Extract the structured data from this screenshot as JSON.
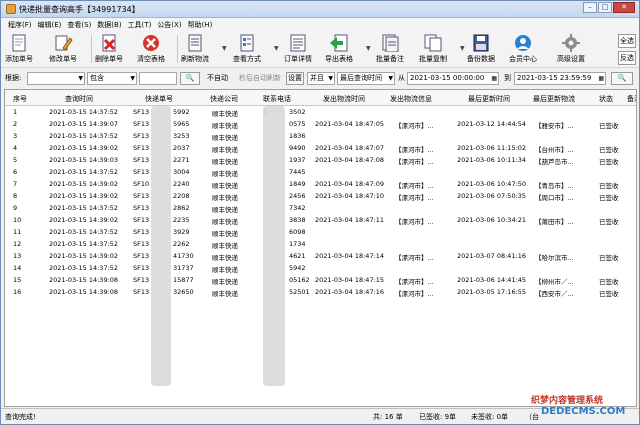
{
  "window": {
    "title": "快递批量查询高手【34991734】",
    "buttons": {
      "minimize": "–",
      "maximize": "□",
      "close": "✕"
    }
  },
  "menu": [
    "程序(F)",
    "编辑(E)",
    "查看(S)",
    "数据(B)",
    "工具(T)",
    "公告(X)",
    "帮助(H)"
  ],
  "toolbar": {
    "add": "添加单号",
    "edit": "修改单号",
    "delete": "删除单号",
    "clear": "清空表格",
    "refresh": "刷新物流",
    "view": "查看方式",
    "detail": "订单详情",
    "export": "导出表格",
    "batch_note": "批量备注",
    "batch_copy": "批量复制",
    "backup": "备份数据",
    "member": "会员中心",
    "settings": "高级设置",
    "select_all": "全选",
    "invert": "反选"
  },
  "filter": {
    "label": "根据:",
    "field_value": "",
    "mode_value": "包含",
    "search_value": "",
    "auto_check": "不自动",
    "auto_refresh": "秒后自动刷新",
    "set_btn": "设置",
    "logic_value": "并且",
    "time_field": "最后查询时间",
    "from_label": "从",
    "from_date": "2021-03-15 00:00:00",
    "to_label": "到",
    "to_date": "2021-03-15 23:59:59"
  },
  "table": {
    "headers": [
      "序号",
      "查询时间",
      "快递单号",
      "快递公司",
      "联系电话",
      "发出物流时间",
      "发出物流信息",
      "最后更新时间",
      "最后更新物流",
      "状态",
      "备注"
    ],
    "rows": [
      [
        "1",
        "2021-03-15 14:37:52",
        "SF13",
        "5992",
        "顺丰快递",
        "1",
        "3502",
        "",
        "",
        "",
        "",
        ""
      ],
      [
        "2",
        "2021-03-15 14:39:07",
        "SF13",
        "5965",
        "顺丰快递",
        "",
        "0575",
        "2021-03-04 18:47:05",
        "【漯河市】...",
        "2021-03-12 14:44:54",
        "【雅安市】...",
        "已签收"
      ],
      [
        "3",
        "2021-03-15 14:37:52",
        "SF13",
        "3253",
        "顺丰快递",
        "",
        "1836",
        "",
        "",
        "",
        "",
        ""
      ],
      [
        "4",
        "2021-03-15 14:39:02",
        "SF13",
        "2037",
        "顺丰快递",
        "",
        "9490",
        "2021-03-04 18:47:07",
        "【漯河市】...",
        "2021-03-06 11:15:02",
        "【台州市】...",
        "已签收"
      ],
      [
        "5",
        "2021-03-15 14:39:03",
        "SF13",
        "2271",
        "顺丰快递",
        "",
        "1937",
        "2021-03-04 18:47:08",
        "【漯河市】...",
        "2021-03-06 10:11:34",
        "【葫芦岛市...",
        "已签收"
      ],
      [
        "6",
        "2021-03-15 14:37:52",
        "SF13",
        "3004",
        "顺丰快递",
        "",
        "7445",
        "",
        "",
        "",
        "",
        ""
      ],
      [
        "7",
        "2021-03-15 14:39:02",
        "SF10",
        "2240",
        "顺丰快递",
        "",
        "1849",
        "2021-03-04 18:47:09",
        "【漯河市】...",
        "2021-03-06 10:47:50",
        "【青岛市】...",
        "已签收"
      ],
      [
        "8",
        "2021-03-15 14:39:02",
        "SF13",
        "2208",
        "顺丰快递",
        "",
        "2456",
        "2021-03-04 18:47:10",
        "【漯河市】...",
        "2021-03-06 07:50:35",
        "【周口市】...",
        "已签收"
      ],
      [
        "9",
        "2021-03-15 14:37:52",
        "SF13",
        "2862",
        "顺丰快递",
        "",
        "7342",
        "",
        "",
        "",
        "",
        ""
      ],
      [
        "10",
        "2021-03-15 14:39:02",
        "SF13",
        "2235",
        "顺丰快递",
        "",
        "3838",
        "2021-03-04 18:47:11",
        "【漯河市】...",
        "2021-03-06 10:34:21",
        "【莆田市】...",
        "已签收"
      ],
      [
        "11",
        "2021-03-15 14:37:52",
        "SF13",
        "3929",
        "顺丰快递",
        "",
        "6098",
        "",
        "",
        "",
        "",
        ""
      ],
      [
        "12",
        "2021-03-15 14:37:52",
        "SF13",
        "2262",
        "顺丰快递",
        "",
        "1734",
        "",
        "",
        "",
        "",
        ""
      ],
      [
        "13",
        "2021-03-15 14:39:02",
        "SF13",
        "41730",
        "顺丰快递",
        "",
        "4621",
        "2021-03-04 18:47:14",
        "【漯河市】...",
        "2021-03-07 08:41:16",
        "【哈尔滨市...",
        "已签收"
      ],
      [
        "14",
        "2021-03-15 14:37:52",
        "SF13",
        "31737",
        "顺丰快递",
        "",
        "5942",
        "",
        "",
        "",
        "",
        ""
      ],
      [
        "15",
        "2021-03-15 14:39:08",
        "SF13",
        "15877",
        "顺丰快递",
        "",
        "05162",
        "2021-03-04 18:47:15",
        "【漯河市】...",
        "2021-03-06 14:41:45",
        "【柳州市／...",
        "已签收"
      ],
      [
        "16",
        "2021-03-15 14:39:08",
        "SF13",
        "32650",
        "顺丰快递",
        "",
        "52501",
        "2021-03-04 18:47:16",
        "【漯河市】...",
        "2021-03-05 17:16:55",
        "【西安市／...",
        "已签收"
      ]
    ]
  },
  "status": {
    "message": "查询完成!",
    "total": "共: 16 单",
    "signed": "已签收: 9单",
    "unsigned": "未签收: 0单",
    "more": "（台"
  },
  "watermark": {
    "line1": "织梦内容管理系统",
    "line2": "DEDECMS.COM"
  },
  "colors": {
    "title_bg": "#c4d7ef",
    "close": "#c9473f",
    "accent": "#2a7fd3"
  }
}
